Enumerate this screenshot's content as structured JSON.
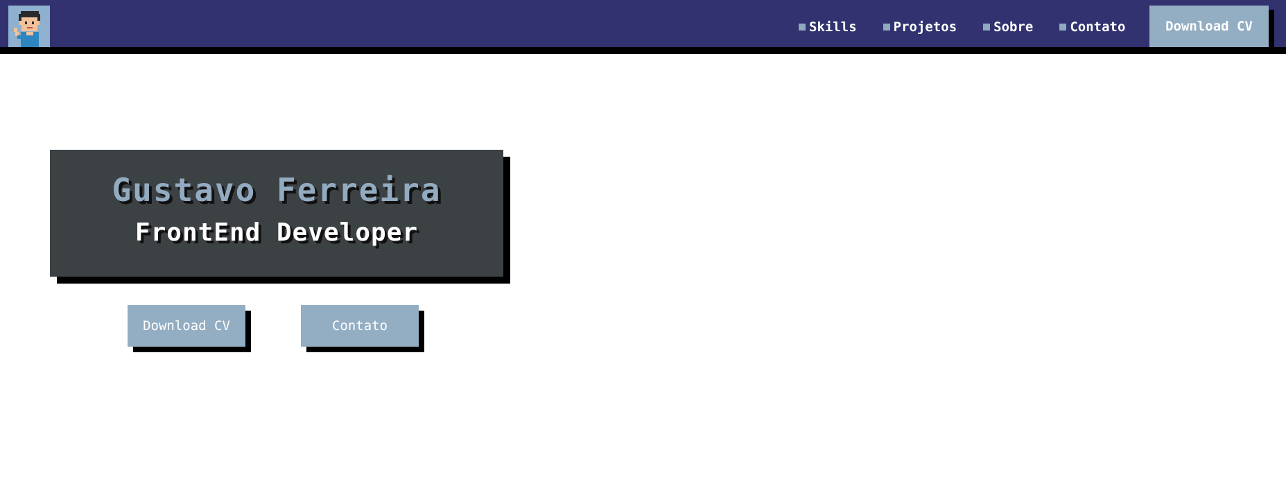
{
  "header": {
    "avatar_icon": "pixel-boy-waving-icon",
    "nav": [
      {
        "label": "Skills",
        "bullet_icon": "square-bullet-icon"
      },
      {
        "label": "Projetos",
        "bullet_icon": "square-bullet-icon"
      },
      {
        "label": "Sobre",
        "bullet_icon": "square-bullet-icon"
      },
      {
        "label": "Contato",
        "bullet_icon": "square-bullet-icon"
      }
    ],
    "download_label": "Download CV"
  },
  "hero": {
    "name": "Gustavo Ferreira",
    "role": "FrontEnd Developer",
    "download_label": "Download CV",
    "contact_label": "Contato"
  },
  "colors": {
    "navbar_bg": "#31326f",
    "button_bg": "#93adc2",
    "hero_bg": "#3c4144",
    "name_color": "#93abc1",
    "shadow": "#000000"
  }
}
